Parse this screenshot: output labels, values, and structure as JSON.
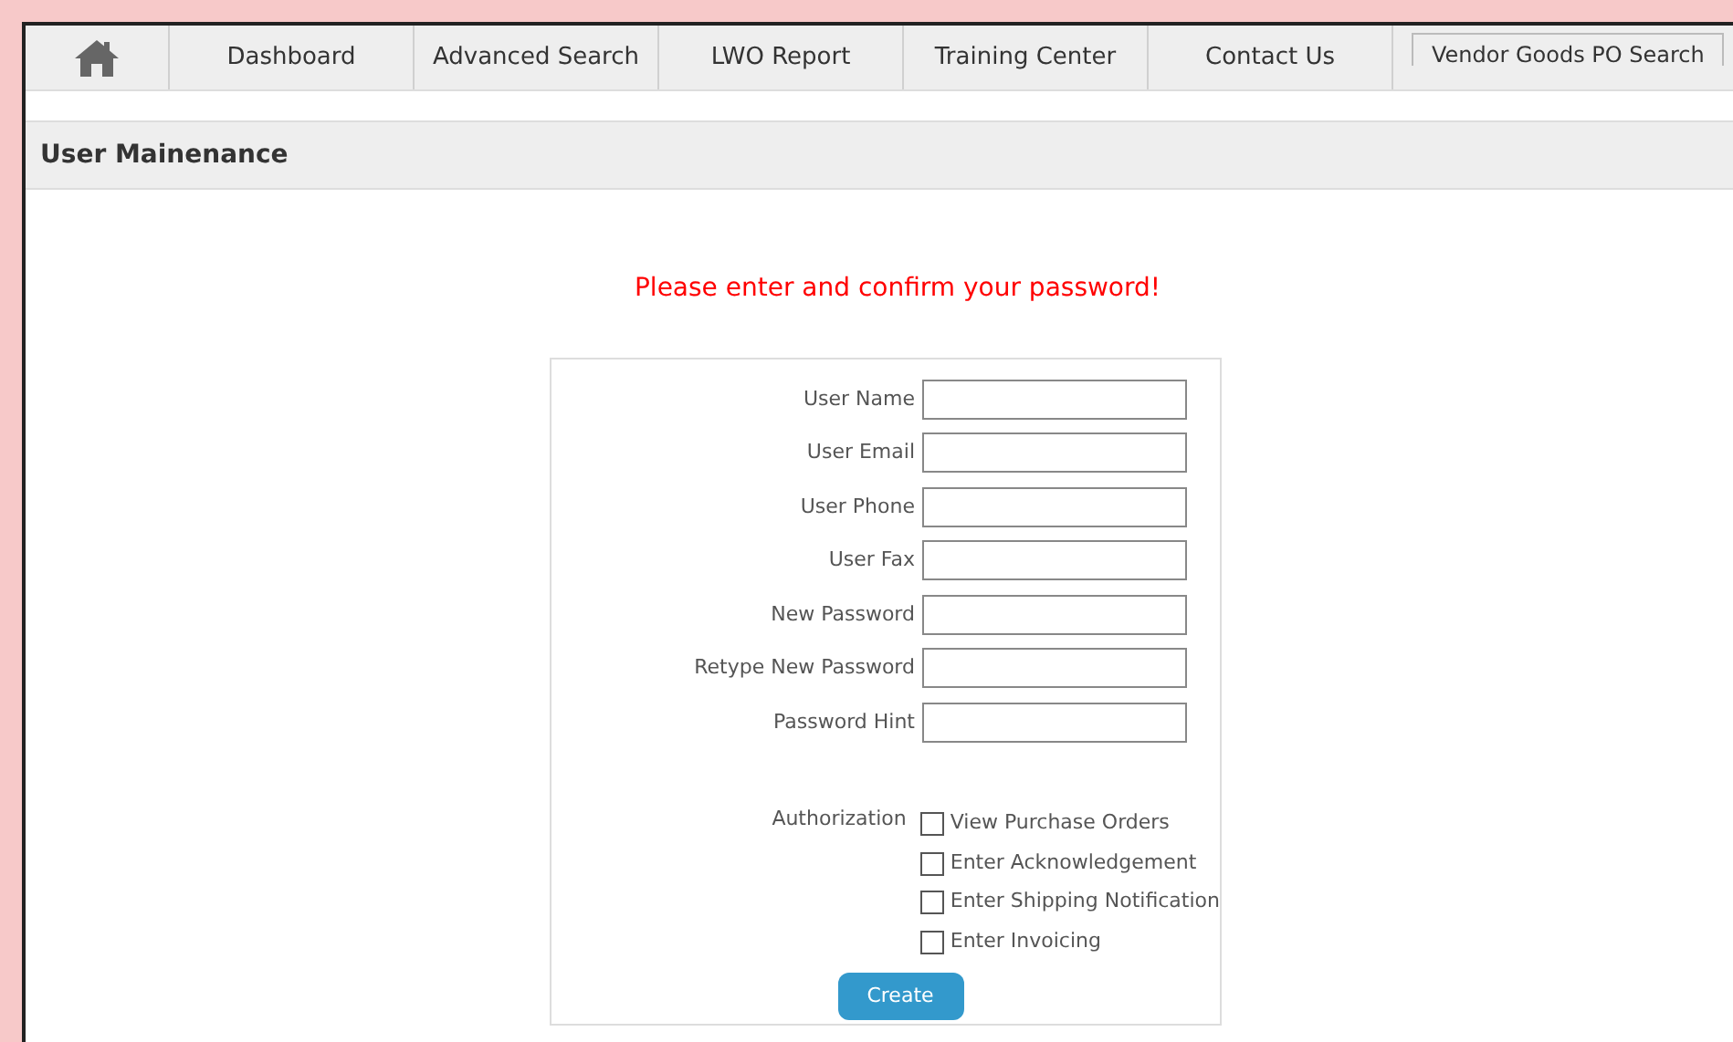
{
  "nav": {
    "items": [
      {
        "label": "Dashboard"
      },
      {
        "label": "Advanced Search"
      },
      {
        "label": "LWO Report"
      },
      {
        "label": "Training Center"
      },
      {
        "label": "Contact Us"
      }
    ],
    "search_button": "Vendor Goods PO Search"
  },
  "page_title": "User Mainenance",
  "message": "Please enter and confirm your password!",
  "fields": [
    {
      "label": "User Name"
    },
    {
      "label": "User Email"
    },
    {
      "label": "User Phone"
    },
    {
      "label": "User Fax"
    },
    {
      "label": "New Password"
    },
    {
      "label": "Retype New Password"
    },
    {
      "label": "Password Hint"
    }
  ],
  "authorization": {
    "label": "Authorization",
    "options": [
      {
        "label": "View Purchase Orders",
        "checked": false
      },
      {
        "label": "Enter Acknowledgement",
        "checked": false
      },
      {
        "label": "Enter Shipping Notification",
        "checked": false
      },
      {
        "label": "Enter Invoicing",
        "checked": false
      }
    ]
  },
  "submit": "Create"
}
